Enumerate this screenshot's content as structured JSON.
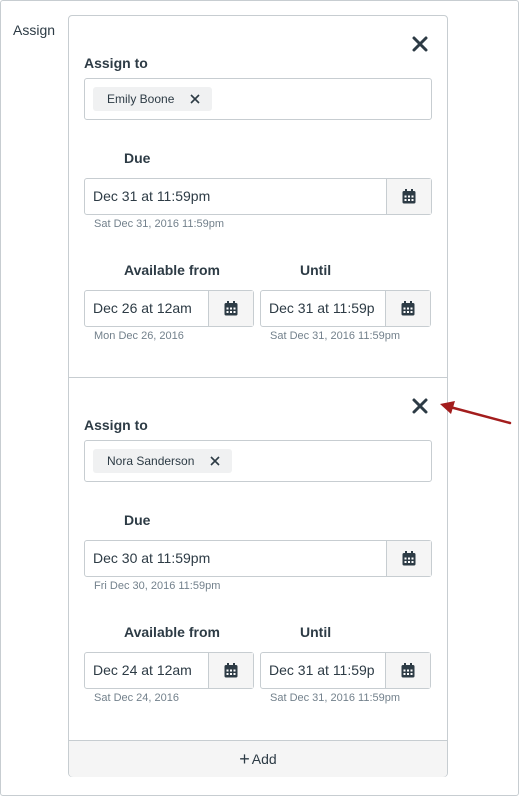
{
  "assign_label": "Assign",
  "add_label": "Add",
  "icons": {
    "remove": "close-icon",
    "token_remove": "close-icon",
    "calendar": "calendar-icon",
    "add": "plus-icon"
  },
  "colors": {
    "arrow": "#a31d1d",
    "border": "#c7cdd1",
    "text": "#2d3b45",
    "hint": "#73818c"
  },
  "cards": [
    {
      "assign_to_label": "Assign to",
      "assignee": "Emily Boone",
      "due_label": "Due",
      "due_value": "Dec 31 at 11:59pm",
      "due_hint": "Sat Dec 31, 2016 11:59pm",
      "available_from_label": "Available from",
      "available_from_value": "Dec 26 at 12am",
      "available_from_hint": "Mon Dec 26, 2016",
      "until_label": "Until",
      "until_value": "Dec 31 at 11:59p",
      "until_hint": "Sat Dec 31, 2016 11:59pm"
    },
    {
      "assign_to_label": "Assign to",
      "assignee": "Nora Sanderson",
      "due_label": "Due",
      "due_value": "Dec 30 at 11:59pm",
      "due_hint": "Fri Dec 30, 2016 11:59pm",
      "available_from_label": "Available from",
      "available_from_value": "Dec 24 at 12am",
      "available_from_hint": "Sat Dec 24, 2016",
      "until_label": "Until",
      "until_value": "Dec 31 at 11:59p",
      "until_hint": "Sat Dec 31, 2016 11:59pm"
    }
  ]
}
